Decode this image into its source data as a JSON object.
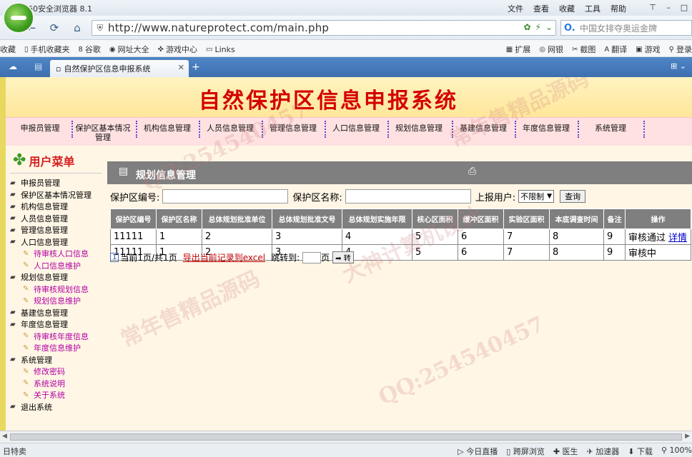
{
  "browser": {
    "app_name": "360安全浏览器 8.1",
    "menu": [
      "文件",
      "查看",
      "收藏",
      "工具",
      "帮助"
    ],
    "url": "http://www.natureprotect.com/main.php",
    "search_text": "中国女排夺奥运金牌",
    "favorites_left": [
      "收藏",
      "手机收藏夹",
      "谷歌",
      "网址大全",
      "游戏中心",
      "Links"
    ],
    "favorites_right": [
      "扩展",
      "网银",
      "截图",
      "翻译",
      "游戏",
      "登录"
    ],
    "tab_title": "自然保护区信息申报系统"
  },
  "page": {
    "banner_title": "自然保护区信息申报系统",
    "nav": [
      "申报员管理",
      "保护区基本情况管理",
      "机构信息管理",
      "人员信息管理",
      "管理信息管理",
      "人口信息管理",
      "规划信息管理",
      "基建信息管理",
      "年度信息管理",
      "系统管理"
    ],
    "sidebar_title": "用户菜单",
    "sidebar_items": [
      {
        "label": "申报员管理",
        "level": 1
      },
      {
        "label": "保护区基本情况管理",
        "level": 1
      },
      {
        "label": "机构信息管理",
        "level": 1
      },
      {
        "label": "人员信息管理",
        "level": 1
      },
      {
        "label": "管理信息管理",
        "level": 1
      },
      {
        "label": "人口信息管理",
        "level": 1
      },
      {
        "label": "待审核人口信息",
        "level": 2
      },
      {
        "label": "人口信息维护",
        "level": 2
      },
      {
        "label": "规划信息管理",
        "level": 1
      },
      {
        "label": "待审核规划信息",
        "level": 2
      },
      {
        "label": "规划信息维护",
        "level": 2
      },
      {
        "label": "基建信息管理",
        "level": 1
      },
      {
        "label": "年度信息管理",
        "level": 1
      },
      {
        "label": "待审核年度信息",
        "level": 2
      },
      {
        "label": "年度信息维护",
        "level": 2
      },
      {
        "label": "系统管理",
        "level": 1
      },
      {
        "label": "修改密码",
        "level": 2
      },
      {
        "label": "系统说明",
        "level": 2
      },
      {
        "label": "关于系统",
        "level": 2
      },
      {
        "label": "退出系统",
        "level": 1
      }
    ],
    "panel_title": "规划信息管理",
    "filter": {
      "code_label": "保护区编号:",
      "name_label": "保护区名称:",
      "user_label": "上报用户:",
      "user_selected": "不限制",
      "query_button": "查询"
    },
    "table": {
      "headers": [
        "保护区编号",
        "保护区名称",
        "总体规划批准单位",
        "总体规划批准文号",
        "总体规划实施年限",
        "核心区面积",
        "缓冲区面积",
        "实验区面积",
        "本底调查时间",
        "备注",
        "操作"
      ],
      "rows": [
        [
          "11111",
          "1",
          "2",
          "3",
          "4",
          "5",
          "6",
          "7",
          "8",
          "9",
          "审核通过"
        ],
        [
          "11111",
          "1",
          "2",
          "3",
          "4",
          "5",
          "6",
          "7",
          "8",
          "9",
          "审核中"
        ]
      ],
      "detail_link": "详情"
    },
    "pager": {
      "page_num": "1",
      "info": "当前1页/共1页",
      "export": "导出当前记录到excel",
      "jump_label": "跳转到:",
      "page_unit": "页",
      "go_button": "转"
    }
  },
  "statusbar": {
    "left": "日特卖",
    "right": [
      "今日直播",
      "跨屏浏览",
      "医生",
      "加速器",
      "下载",
      "100%"
    ]
  },
  "watermarks": [
    "QQ:254540457",
    "大神计算机设计",
    "常年售精品源码"
  ]
}
